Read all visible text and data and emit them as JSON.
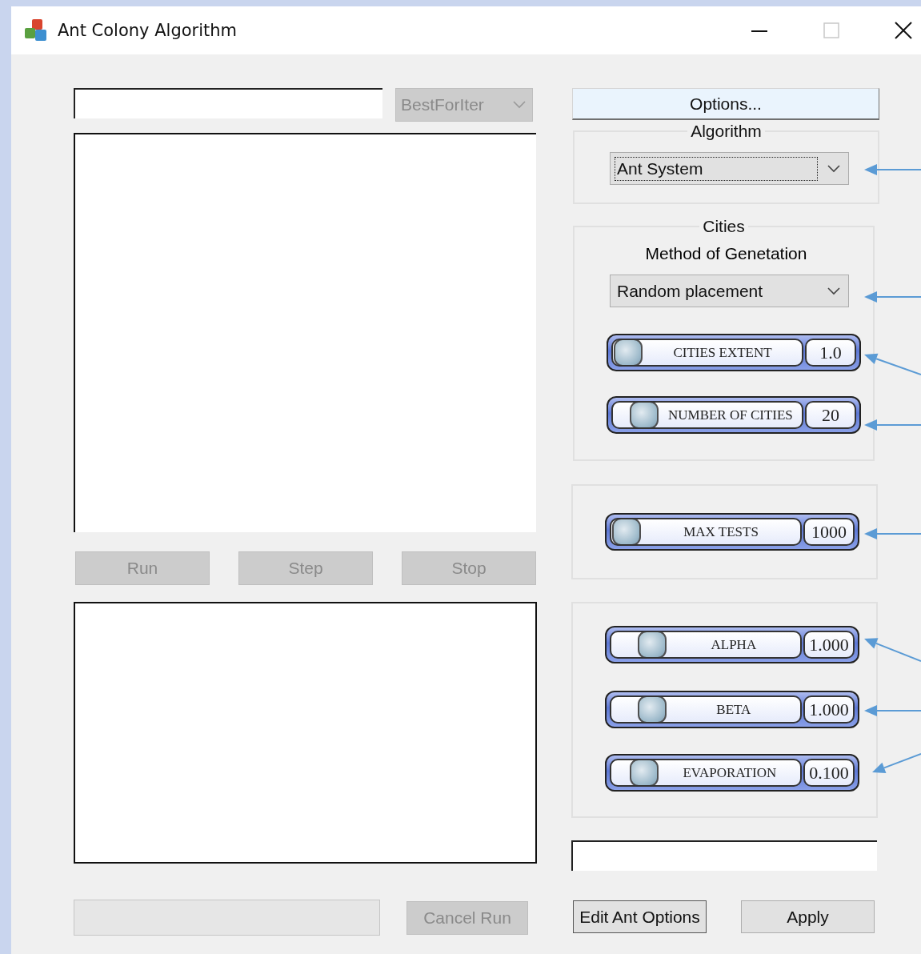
{
  "window": {
    "title": "Ant Colony Algorithm",
    "maximize_disabled": true
  },
  "view_combo": {
    "value": "BestForIter",
    "disabled": true
  },
  "run_buttons": [
    {
      "label": "Run",
      "disabled": true
    },
    {
      "label": "Step",
      "disabled": true
    },
    {
      "label": "Stop",
      "disabled": true
    }
  ],
  "cancel_button": {
    "label": "Cancel Run",
    "disabled": true
  },
  "options_button": {
    "label": "Options..."
  },
  "algorithm": {
    "legend": "Algorithm",
    "value": "Ant System",
    "focused": true
  },
  "cities": {
    "legend": "Cities",
    "method_label": "Method of Genetation",
    "method": "Random placement",
    "focused": false,
    "sliders": [
      {
        "label": "CITIES EXTENT",
        "value": "1.0",
        "level": 0
      },
      {
        "label": "NUMBER OF CITIES",
        "value": "20",
        "level": 0.1
      }
    ]
  },
  "tests": {
    "sliders": [
      {
        "label": "MAX TESTS",
        "value": "1000",
        "level": 0
      }
    ]
  },
  "parameters": {
    "sliders": [
      {
        "label": "ALPHA",
        "value": "1.000",
        "level": 0.16
      },
      {
        "label": "BETA",
        "value": "1.000",
        "level": 0.16
      },
      {
        "label": "EVAPORATION",
        "value": "0.100",
        "level": 0.11
      }
    ]
  },
  "bottom_buttons": [
    {
      "label": "Edit Ant Options",
      "focused": true
    },
    {
      "label": "Apply",
      "focused": false
    }
  ]
}
